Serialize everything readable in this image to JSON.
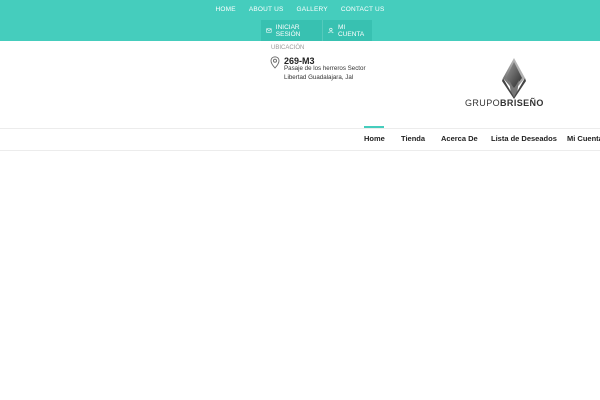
{
  "top_nav": {
    "items": [
      "HOME",
      "ABOUT US",
      "GALLERY",
      "CONTACT US"
    ]
  },
  "account": {
    "login_label": "INICIAR SESIÓN",
    "account_label": "MI CUENTA",
    "login_icon": "login-icon",
    "account_icon": "user-icon"
  },
  "location": {
    "label": "UBICACIÓN",
    "title": "269-M3",
    "line1": "Pasaje de los herreros Sector",
    "line2": "Libertad Guadalajara, Jal",
    "icon": "map-pin-icon"
  },
  "logo": {
    "text_light": "GRUPO",
    "text_bold": "BRISEÑO"
  },
  "main_nav": {
    "items": [
      "Home",
      "Tienda",
      "Acerca De",
      "Lista de Deseados",
      "Mi Cuenta"
    ],
    "active_index": 0
  },
  "colors": {
    "accent": "#45cdbd",
    "accent_dark": "#38c1b1"
  }
}
